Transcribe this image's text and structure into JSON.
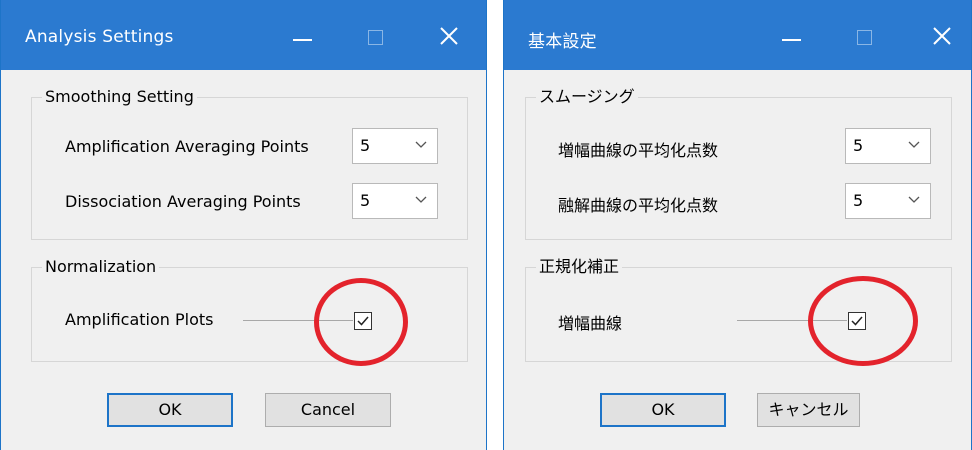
{
  "dialog_en": {
    "title": "Analysis Settings",
    "smoothing_group": "Smoothing Setting",
    "amplification_label": "Amplification Averaging Points",
    "amplification_value": "5",
    "dissociation_label": "Dissociation Averaging Points",
    "dissociation_value": "5",
    "normalization_group": "Normalization",
    "amplification_plots_label": "Amplification Plots",
    "amplification_plots_checked": true,
    "ok_label": "OK",
    "cancel_label": "Cancel"
  },
  "dialog_ja": {
    "title": "基本設定",
    "smoothing_group": "スムージング",
    "amplification_label": "増幅曲線の平均化点数",
    "amplification_value": "5",
    "dissociation_label": "融解曲線の平均化点数",
    "dissociation_value": "5",
    "normalization_group": "正規化補正",
    "amplification_plots_label": "増幅曲線",
    "amplification_plots_checked": true,
    "ok_label": "OK",
    "cancel_label": "キャンセル"
  },
  "colors": {
    "titlebar": "#2b7ad0",
    "highlight_ring": "#e3232c",
    "default_button_border": "#1d74c8"
  },
  "icons": [
    "minimize-icon",
    "maximize-icon",
    "close-icon",
    "chevron-down-icon",
    "checkmark-icon"
  ]
}
